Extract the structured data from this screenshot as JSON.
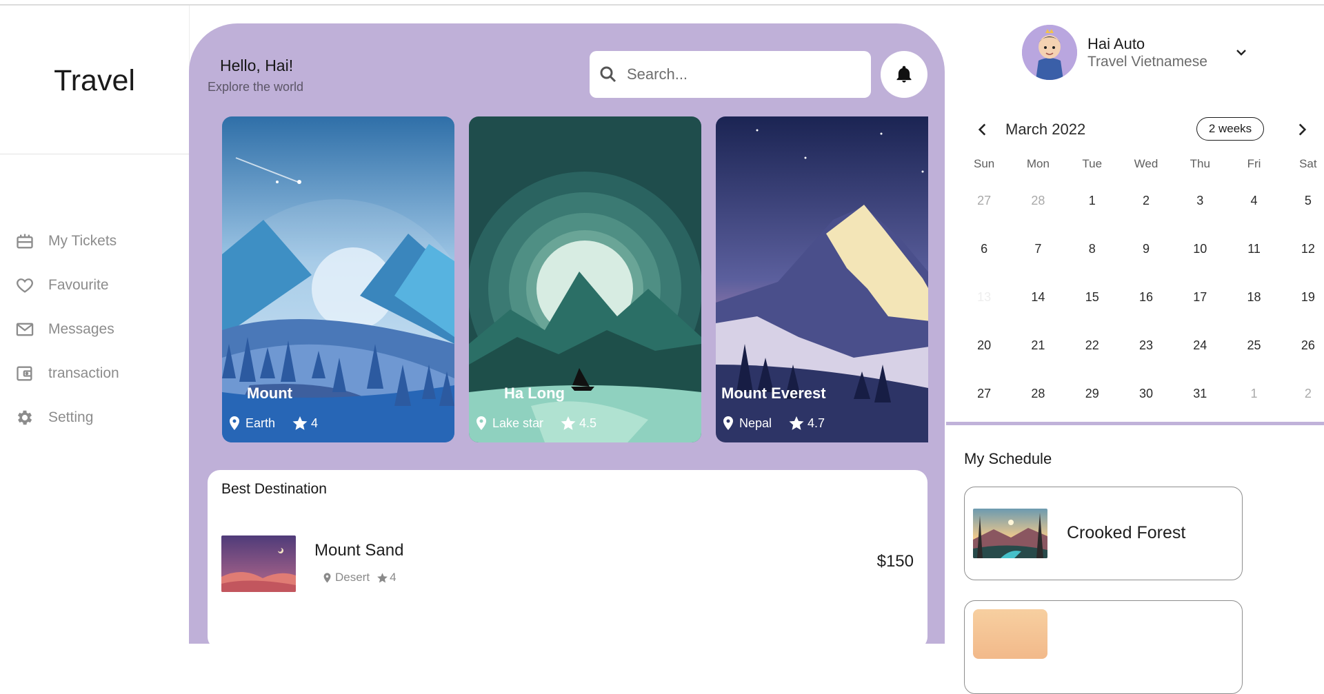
{
  "app": {
    "brand": "Travel"
  },
  "sidebar": {
    "items": [
      {
        "label": "My Tickets",
        "icon": "ticket-icon"
      },
      {
        "label": "Favourite",
        "icon": "heart-icon"
      },
      {
        "label": "Messages",
        "icon": "mail-icon"
      },
      {
        "label": "transaction",
        "icon": "wallet-icon"
      },
      {
        "label": "Setting",
        "icon": "gear-icon"
      }
    ]
  },
  "header": {
    "greeting": "Hello, Hai!",
    "subtitle": "Explore the world",
    "search_placeholder": "Search..."
  },
  "cards": [
    {
      "title": "Mount",
      "location": "Earth",
      "rating": "4"
    },
    {
      "title": "Ha Long",
      "location": "Lake star",
      "rating": "4.5"
    },
    {
      "title": "Mount Everest",
      "location": "Nepal",
      "rating": "4.7"
    }
  ],
  "best_destination": {
    "title": "Best Destination",
    "items": [
      {
        "name": "Mount Sand",
        "location": "Desert",
        "rating": "4",
        "price": "$150"
      }
    ]
  },
  "user": {
    "name": "Hai Auto",
    "role": "Travel Vietnamese"
  },
  "calendar": {
    "month_label": "March 2022",
    "view_label": "2 weeks",
    "weekdays": [
      "Sun",
      "Mon",
      "Tue",
      "Wed",
      "Thu",
      "Fri",
      "Sat"
    ],
    "weeks": [
      [
        "27",
        "28",
        "1",
        "2",
        "3",
        "4",
        "5"
      ],
      [
        "6",
        "7",
        "8",
        "9",
        "10",
        "11",
        "12"
      ],
      [
        "13",
        "14",
        "15",
        "16",
        "17",
        "18",
        "19"
      ],
      [
        "20",
        "21",
        "22",
        "23",
        "24",
        "25",
        "26"
      ],
      [
        "27",
        "28",
        "29",
        "30",
        "31",
        "1",
        "2"
      ]
    ]
  },
  "schedule": {
    "title": "My Schedule",
    "items": [
      {
        "name": "Crooked Forest"
      },
      {
        "name": ""
      }
    ]
  },
  "colors": {
    "accent": "#bfb0d8",
    "panel": "#ffffff",
    "text_muted": "#8c8c8c"
  }
}
